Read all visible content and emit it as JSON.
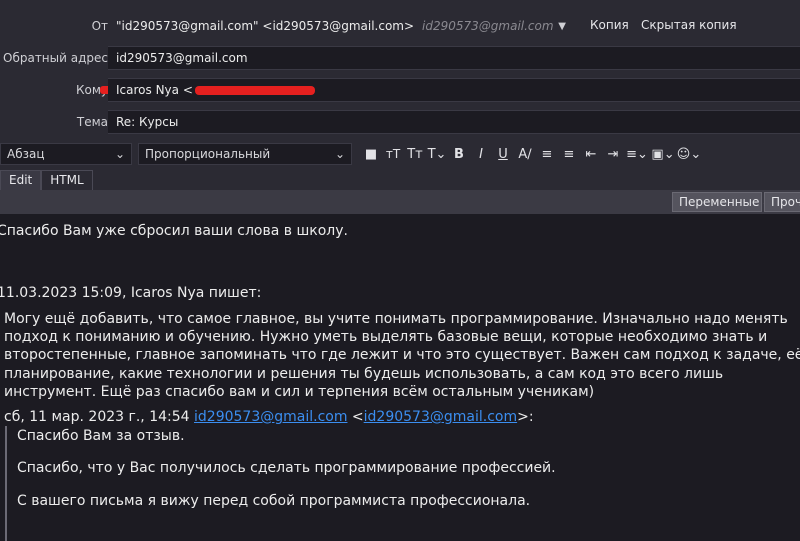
{
  "header": {
    "from": {
      "label": "От",
      "value": "\"id290573@gmail.com\" <id290573@gmail.com>",
      "hint": "id290573@gmail.com",
      "cc": "Копия",
      "bcc": "Скрытая копия"
    },
    "reply_to": {
      "label": "Обратный адрес",
      "value": "id290573@gmail.com"
    },
    "to": {
      "label": "Кому",
      "value": "Icaros Nya <"
    },
    "subject": {
      "label": "Тема",
      "value": "Re: Курсы"
    }
  },
  "toolbar": {
    "paragraph": "Абзац",
    "font": "Пропорциональный",
    "icons": [
      "text-color-icon",
      "font-smaller-icon",
      "font-larger-icon",
      "text-style-icon",
      "bold-icon",
      "italic-icon",
      "underline-icon",
      "clear-format-icon",
      "bullet-list-icon",
      "numbered-list-icon",
      "outdent-icon",
      "indent-icon",
      "align-icon",
      "insert-image-icon",
      "emoji-icon"
    ]
  },
  "tabs": [
    "Edit",
    "HTML"
  ],
  "strip": {
    "variables": "Переменные",
    "other": "Проче"
  },
  "body": {
    "line1": "Спасибо Вам уже сбросил ваши слова в школу.",
    "quote_header": "11.03.2023 15:09, Icaros Nya пишет:",
    "quote_lines": [
      "Могу ещё добавить, что самое главное, вы учите понимать программирование. Изначально надо менять",
      "подход к пониманию и обучению. Нужно уметь выделять базовые вещи, которые необходимо знать и",
      "второстепенные, главное запоминать что где лежит и что это существует. Важен сам подход к задаче, её",
      "планирование, какие технологии и решения ты будешь использовать, а сам код это всего лишь",
      "инструмент. Ещё раз спасибо вам и сил и терпения всём остальным ученикам)"
    ],
    "inner_header_prefix": "сб, 11 мар. 2023 г., 14:54 ",
    "inner_email": "id290573@gmail.com",
    "inner_lt": " <",
    "inner_email2": "id290573@gmail.com",
    "inner_suffix": ">:",
    "inner_lines": [
      "Спасибо Вам за отзыв.",
      "Спасибо, что у Вас получилось сделать программирование профессией.",
      "С вашего письма я вижу перед собой программиста профессионала."
    ]
  }
}
